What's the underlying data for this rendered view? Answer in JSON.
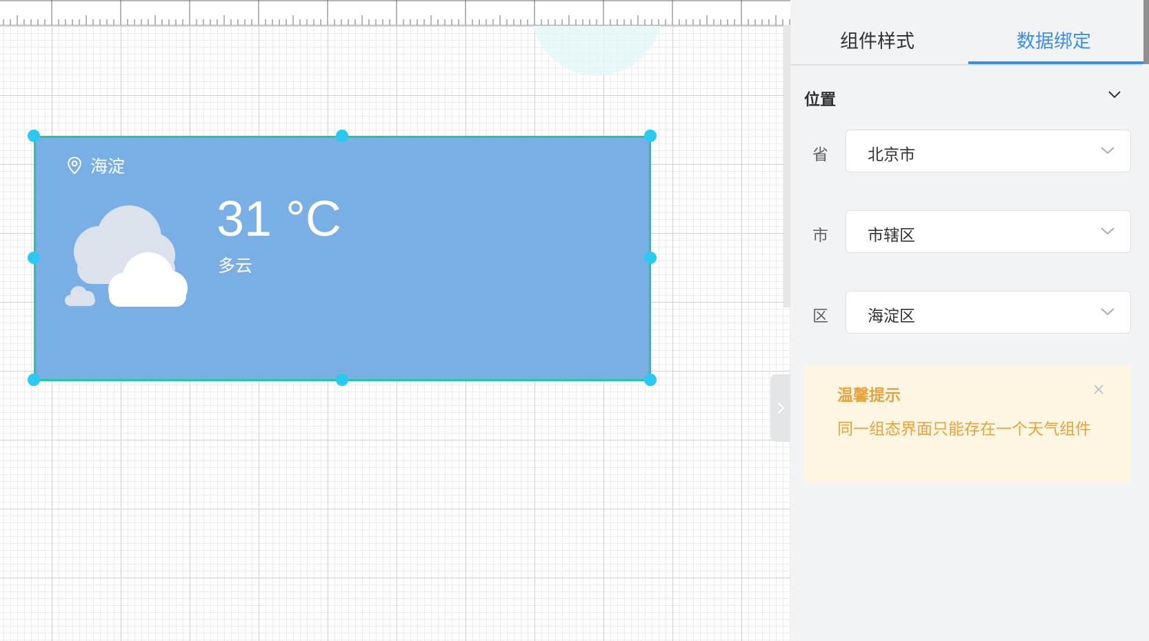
{
  "canvas": {
    "widget": {
      "location": "海淀",
      "temperature": "31 °C",
      "condition": "多云"
    }
  },
  "panel": {
    "tabs": [
      {
        "label": "组件样式",
        "active": false
      },
      {
        "label": "数据绑定",
        "active": true
      }
    ],
    "section": {
      "title": "位置",
      "expanded": true
    },
    "fields": [
      {
        "label": "省",
        "value": "北京市"
      },
      {
        "label": "市",
        "value": "市辖区"
      },
      {
        "label": "区",
        "value": "海淀区"
      }
    ],
    "tip": {
      "title": "温馨提示",
      "message": "同一组态界面只能存在一个天气组件"
    }
  },
  "colors": {
    "accent": "#3a8ee6",
    "widget_bg": "#7aafe6",
    "selection_border": "#23c6a0",
    "handle": "#29c9f3",
    "warning": "#e6a23c"
  },
  "icons": [
    "location-pin-icon",
    "cloudy-weather-icon",
    "chevron-down-icon",
    "close-icon",
    "chevron-right-icon"
  ]
}
